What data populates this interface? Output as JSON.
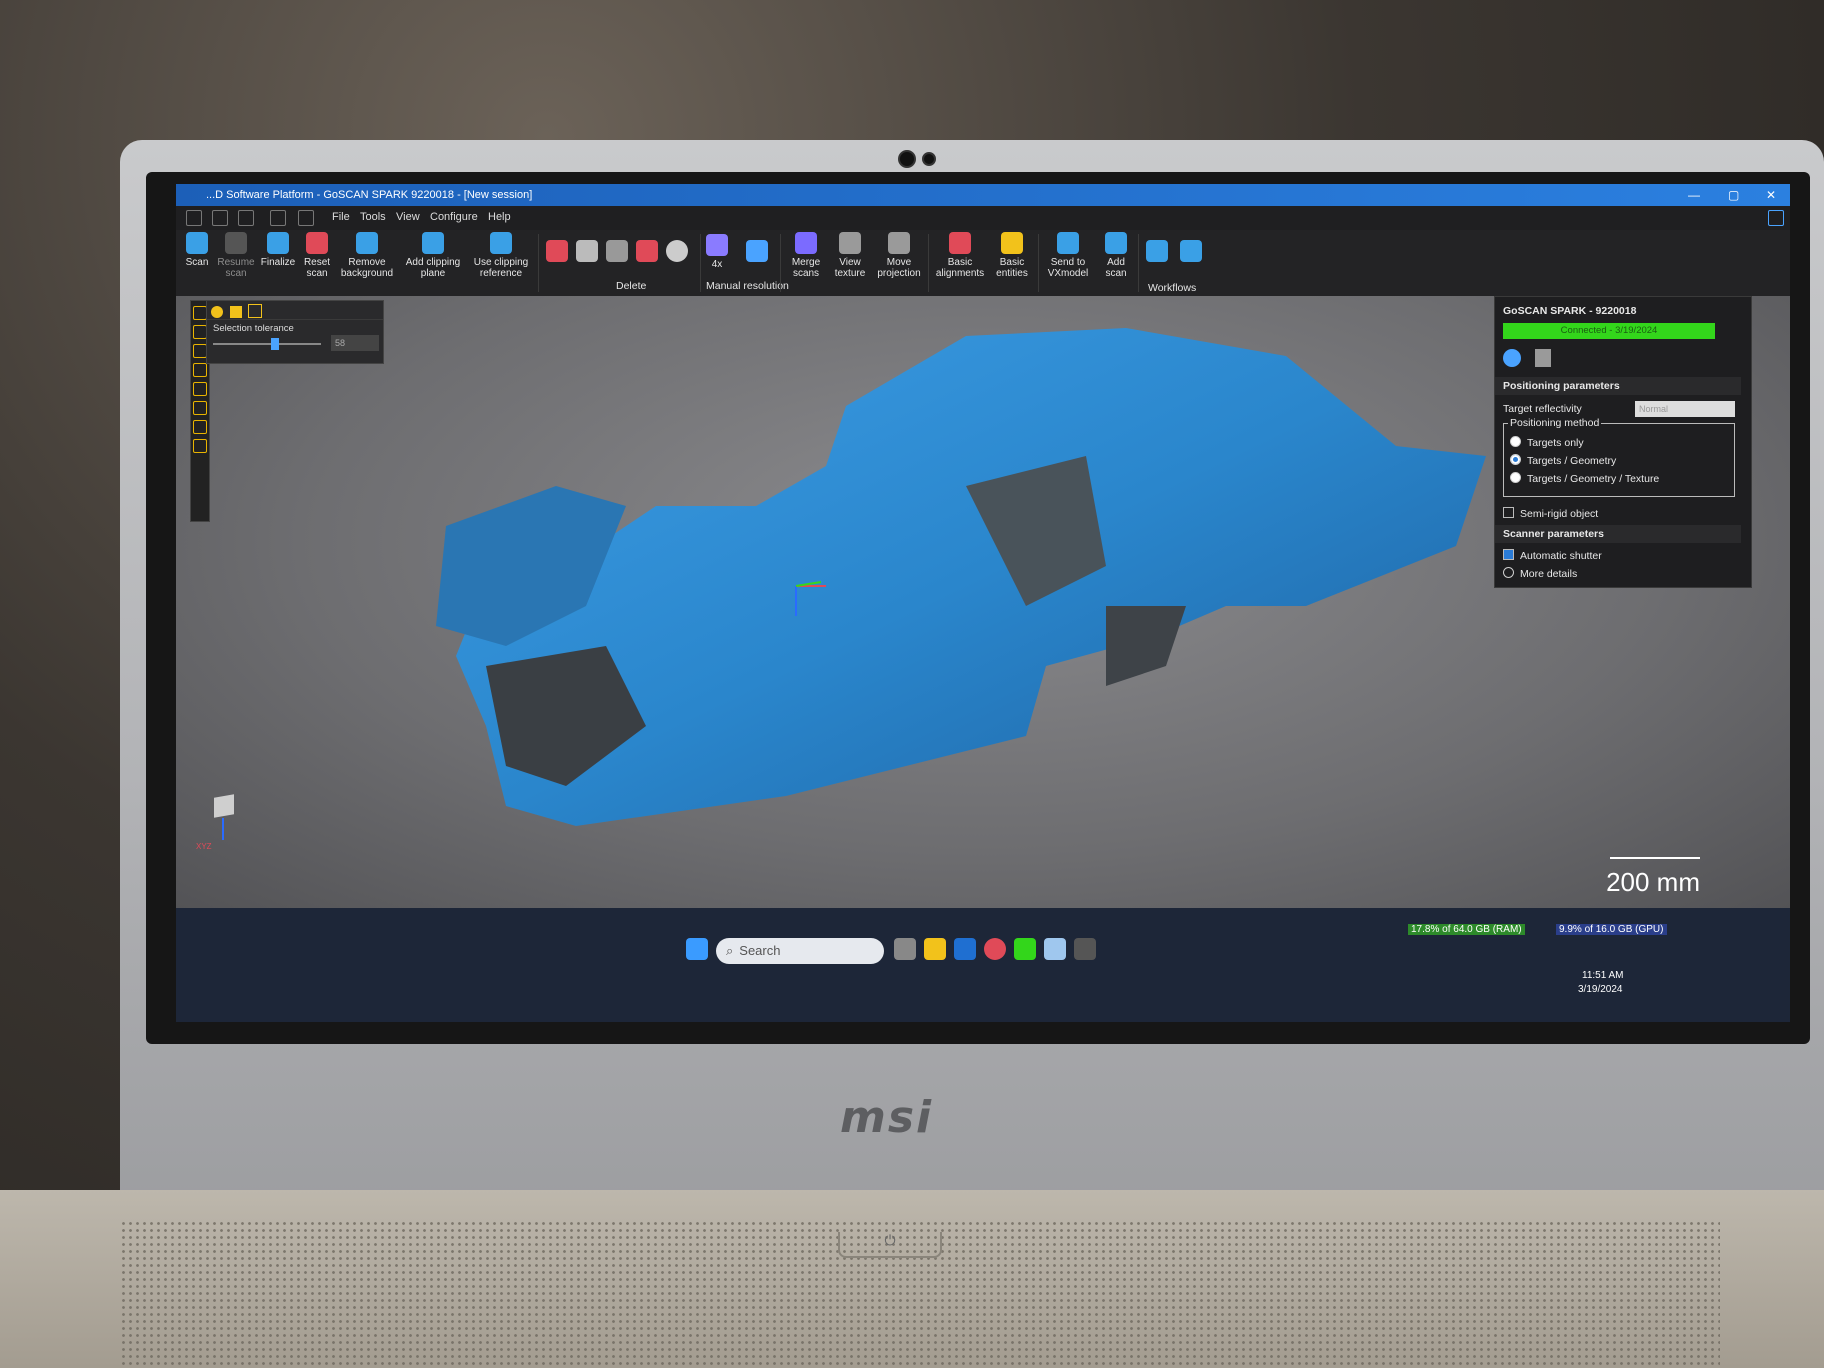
{
  "window": {
    "title": "...D Software Platform - GoSCAN SPARK 9220018 - [New session]",
    "minimize": "—",
    "maximize": "▢",
    "close": "✕"
  },
  "menu": [
    "File",
    "Tools",
    "View",
    "Configure",
    "Help"
  ],
  "ribbon": {
    "buttons": [
      {
        "label": "Scan",
        "color": "#3aa0e6"
      },
      {
        "label": "Resume scan",
        "color": "#777777",
        "dim": true
      },
      {
        "label": "Finalize",
        "color": "#3aa0e6"
      },
      {
        "label": "Reset scan",
        "color": "#e04a58"
      },
      {
        "label": "Remove background",
        "color": "#3aa0e6"
      },
      {
        "label": "Add clipping plane",
        "color": "#3aa0e6"
      },
      {
        "label": "Use clipping reference",
        "color": "#3aa0e6"
      },
      {
        "label": "Merge scans",
        "color": "#7b6bff"
      },
      {
        "label": "View texture",
        "color": "#9a9a9a"
      },
      {
        "label": "Move projection",
        "color": "#9a9a9a"
      },
      {
        "label": "Basic alignments",
        "color": "#e04a58"
      },
      {
        "label": "Basic entities",
        "color": "#f2c21b"
      },
      {
        "label": "Send to VXmodel",
        "color": "#3aa0e6"
      },
      {
        "label": "Add scan",
        "color": "#3aa0e6"
      }
    ],
    "groups": {
      "delete": "Delete",
      "manual_resolution": "Manual resolution",
      "workflows": "Workflows",
      "four_x": "4x"
    }
  },
  "selection_tool": {
    "label": "Selection tolerance",
    "value": "58"
  },
  "panel": {
    "device": "GoSCAN SPARK - 9220018",
    "status": "Connected - 3/19/2024",
    "status_color": "#33d61b",
    "positioning_title": "Positioning parameters",
    "target_reflectivity_label": "Target reflectivity",
    "target_reflectivity_value": "Normal",
    "positioning_method_label": "Positioning method",
    "methods": [
      {
        "label": "Targets only",
        "selected": false
      },
      {
        "label": "Targets / Geometry",
        "selected": true
      },
      {
        "label": "Targets / Geometry / Texture",
        "selected": false
      }
    ],
    "semi_rigid": "Semi-rigid object",
    "scanner_title": "Scanner parameters",
    "auto_shutter": "Automatic shutter",
    "more_details": "More details"
  },
  "viewport": {
    "scale": "200 mm",
    "axes": "XYZ"
  },
  "taskbar": {
    "search": "Search",
    "ram": "17.8% of 64.0 GB (RAM)",
    "gpu": "9.9% of 16.0 GB (GPU)",
    "time": "11:51 AM",
    "date": "3/19/2024"
  },
  "laptop": {
    "brand": "msi"
  }
}
